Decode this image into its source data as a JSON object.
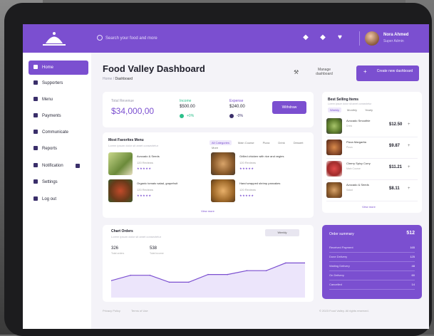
{
  "header": {
    "search_placeholder": "Search your food and more",
    "user_name": "Nora Ahmed",
    "user_role": "Super Admin",
    "icons": [
      "notification-icon",
      "message-icon",
      "heart-icon"
    ]
  },
  "sidebar": {
    "items": [
      {
        "label": "Home",
        "icon": "home-icon",
        "active": true
      },
      {
        "label": "Supporters",
        "icon": "users-icon"
      },
      {
        "label": "Menu",
        "icon": "menu-icon"
      },
      {
        "label": "Payments",
        "icon": "payment-icon"
      },
      {
        "label": "Communicate",
        "icon": "chat-icon"
      },
      {
        "label": "Reports",
        "icon": "report-icon"
      },
      {
        "label": "Notification",
        "icon": "bell-icon"
      },
      {
        "label": "Settings",
        "icon": "gear-icon"
      },
      {
        "label": "Log out",
        "icon": "logout-icon"
      }
    ]
  },
  "page": {
    "title": "Food Valley Dashboard",
    "crumb_root": "Home",
    "crumb_current": "Dashboard",
    "manage_label": "Manage dashboard",
    "create_label": "Create new dashboard"
  },
  "stats": {
    "total_label": "Total Revenue",
    "total_value": "$34,000,00",
    "income_label": "Income",
    "income_value": "$500.00",
    "income_change": "+0%",
    "expense_label": "Expense",
    "expense_value": "$240.00",
    "expense_change": "-0%",
    "button_label": "Withdraw"
  },
  "menu": {
    "title": "Most Favorites Menu",
    "subtitle": "Lorem ipsum dolor sit amet consectetur",
    "tabs": [
      "All Categories",
      "Main Course",
      "Pizza",
      "Drink",
      "Dessert",
      "More"
    ],
    "items": [
      {
        "name": "Avocado & Seeds",
        "meta": "120 Reviews",
        "rating": "★★★★★"
      },
      {
        "name": "Grilled chicken with rice and vegies",
        "meta": "120 Reviews",
        "rating": "★★★★★"
      },
      {
        "name": "Organic tomato salad, grapefruit",
        "meta": "120 Reviews",
        "rating": "★★★★★"
      },
      {
        "name": "Hand wrapped shrimp pancakes",
        "meta": "120 Reviews",
        "rating": "★★★★★"
      }
    ],
    "view_more": "View more"
  },
  "chart_data": {
    "type": "area",
    "title": "Chart Orders",
    "subtitle": "Lorem ipsum dolor sit amet consectetur",
    "dropdown": "Weekly",
    "stat1_value": "326",
    "stat1_label": "Total orders",
    "stat2_value": "538",
    "stat2_label": "Total income",
    "values": [
      44,
      58,
      58,
      40,
      40,
      60,
      60,
      70,
      70,
      90,
      90
    ],
    "ylim": [
      0,
      100
    ]
  },
  "best": {
    "title": "Best Selling Items",
    "subtitle": "Lorem ipsum dolor sit amet consectetur",
    "tabs": [
      "Weekly",
      "Monthly",
      "Yearly"
    ],
    "items": [
      {
        "name": "Avocado Smoothie",
        "line": "Drink",
        "price": "$12.50",
        "sign": "+"
      },
      {
        "name": "Pizza Margarita",
        "line": "Pizza",
        "price": "$9.87",
        "sign": "+"
      },
      {
        "name": "Cherry Spicy Curry",
        "line": "Main Course",
        "price": "$11.21",
        "sign": "+"
      },
      {
        "name": "Avocado & Seeds",
        "line": "Salad",
        "price": "$8.11",
        "sign": "+"
      }
    ],
    "view_more": "View more"
  },
  "orders": {
    "title": "Order summary",
    "total": "512",
    "rows": [
      {
        "label": "Received Payment",
        "value": "165"
      },
      {
        "label": "Done Delivery",
        "value": "125"
      },
      {
        "label": "Waiting Delivery",
        "value": "48"
      },
      {
        "label": "On Delivery",
        "value": "60"
      },
      {
        "label": "Cancelled",
        "value": "14"
      }
    ]
  },
  "footer": {
    "left1": "Privacy Policy",
    "left2": "Terms of Use",
    "right": "© 2023 Food Valley. All rights reserved."
  },
  "colors": {
    "accent": "#7b4fd0",
    "background": "#f4f3f8"
  }
}
